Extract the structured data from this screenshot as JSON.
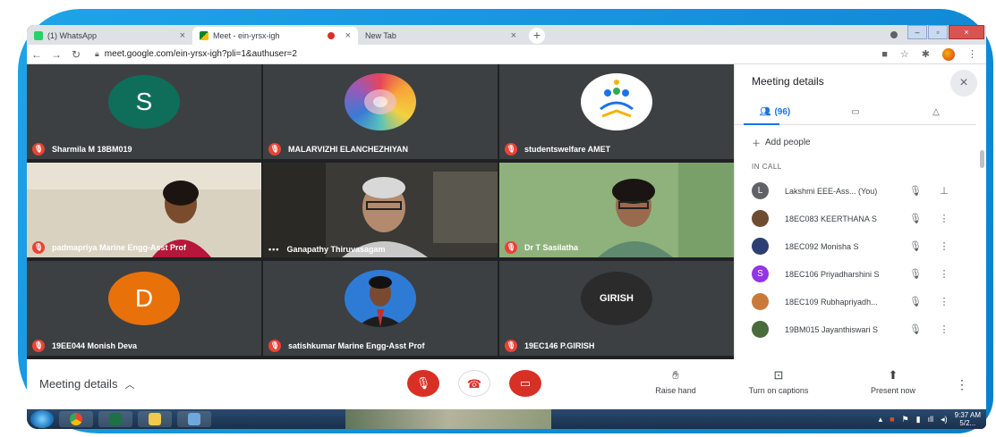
{
  "browser": {
    "tabs": [
      {
        "label": "(1) WhatsApp",
        "active": false
      },
      {
        "label": "Meet - ein-yrsx-igh",
        "active": true
      },
      {
        "label": "New Tab",
        "active": false
      }
    ],
    "new_tab_symbol": "+",
    "url": "meet.google.com/ein-yrsx-igh?pli=1&authuser=2"
  },
  "grid": {
    "tiles": [
      {
        "name": "Sharmila M 18BM019",
        "avatar_letter": "S",
        "avatar_color": "#0f6e5a"
      },
      {
        "name": "MALARVIZHI ELANCHEZHIYAN"
      },
      {
        "name": "studentswelfare AMET"
      },
      {
        "name": "padmapriya Marine Engg-Asst Prof"
      },
      {
        "name": "Ganapathy Thiruvasagam"
      },
      {
        "name": "Dr T Sasilatha"
      },
      {
        "name": "19EE044 Monish Deva",
        "avatar_letter": "D",
        "avatar_color": "#e8710a"
      },
      {
        "name": "satishkumar Marine Engg-Asst Prof"
      },
      {
        "name": "19EC146 P.GIRISH",
        "avatar_text": "GIRISH"
      }
    ]
  },
  "panel": {
    "title": "Meeting details",
    "people_count": "(96)",
    "add_people": "Add people",
    "in_call_label": "IN CALL",
    "participants": [
      {
        "name": "Lakshmi EEE-Ass...",
        "tag": "(You)",
        "avatar": "L",
        "avatar_color": "#5f6368"
      },
      {
        "name": "18EC083 KEERTHANA S",
        "avatar": "",
        "avatar_color": "#6d4c2f"
      },
      {
        "name": "18EC092 Monisha S",
        "avatar": "",
        "avatar_color": "#2c3e72"
      },
      {
        "name": "18EC106 Priyadharshini S",
        "avatar": "S",
        "avatar_color": "#9334e6"
      },
      {
        "name": "18EC109 Rubhapriyadh...",
        "avatar": "",
        "avatar_color": "#c97a3a"
      },
      {
        "name": "19BM015 Jayanthiswari S",
        "avatar": "",
        "avatar_color": "#4a6b3a"
      }
    ]
  },
  "controls": {
    "meeting_details_label": "Meeting details",
    "raise_hand_label": "Raise hand",
    "captions_label": "Turn on captions",
    "present_label": "Present now"
  },
  "taskbar": {
    "time": "9:37 AM",
    "date": "5/2..."
  },
  "colors": {
    "meet_bg": "#202124",
    "tile_bg": "#3c4043",
    "mute_red": "#ea4335",
    "accent_blue": "#1a73e8",
    "frame_blue": "#1fa4e8"
  }
}
